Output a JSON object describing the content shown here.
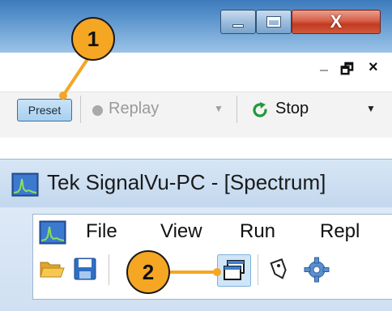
{
  "top_toolbar": {
    "preset_label": "Preset",
    "replay_label": "Replay",
    "stop_label": "Stop"
  },
  "window_buttons": {
    "close_glyph": "X",
    "inner_restore_glyph": "🗗",
    "inner_close_glyph": "×"
  },
  "app": {
    "title": "Tek SignalVu-PC - [Spectrum]"
  },
  "menu": {
    "items": [
      "File",
      "View",
      "Run",
      "Repl"
    ]
  },
  "callouts": [
    "1",
    "2"
  ],
  "colors": {
    "callout_fill": "#f5a623",
    "preset_fill": "#a9d0ef",
    "stop_icon": "#1f9a3a",
    "window_close": "#c23a22"
  },
  "icons": [
    "minimize-icon",
    "maximize-icon",
    "close-icon",
    "record-dot-icon",
    "dropdown-arrow-icon",
    "refresh-stop-icon",
    "app-logo-icon",
    "open-folder-icon",
    "save-icon",
    "back-arrow-icon",
    "windows-icon",
    "tag-icon",
    "gear-icon"
  ]
}
